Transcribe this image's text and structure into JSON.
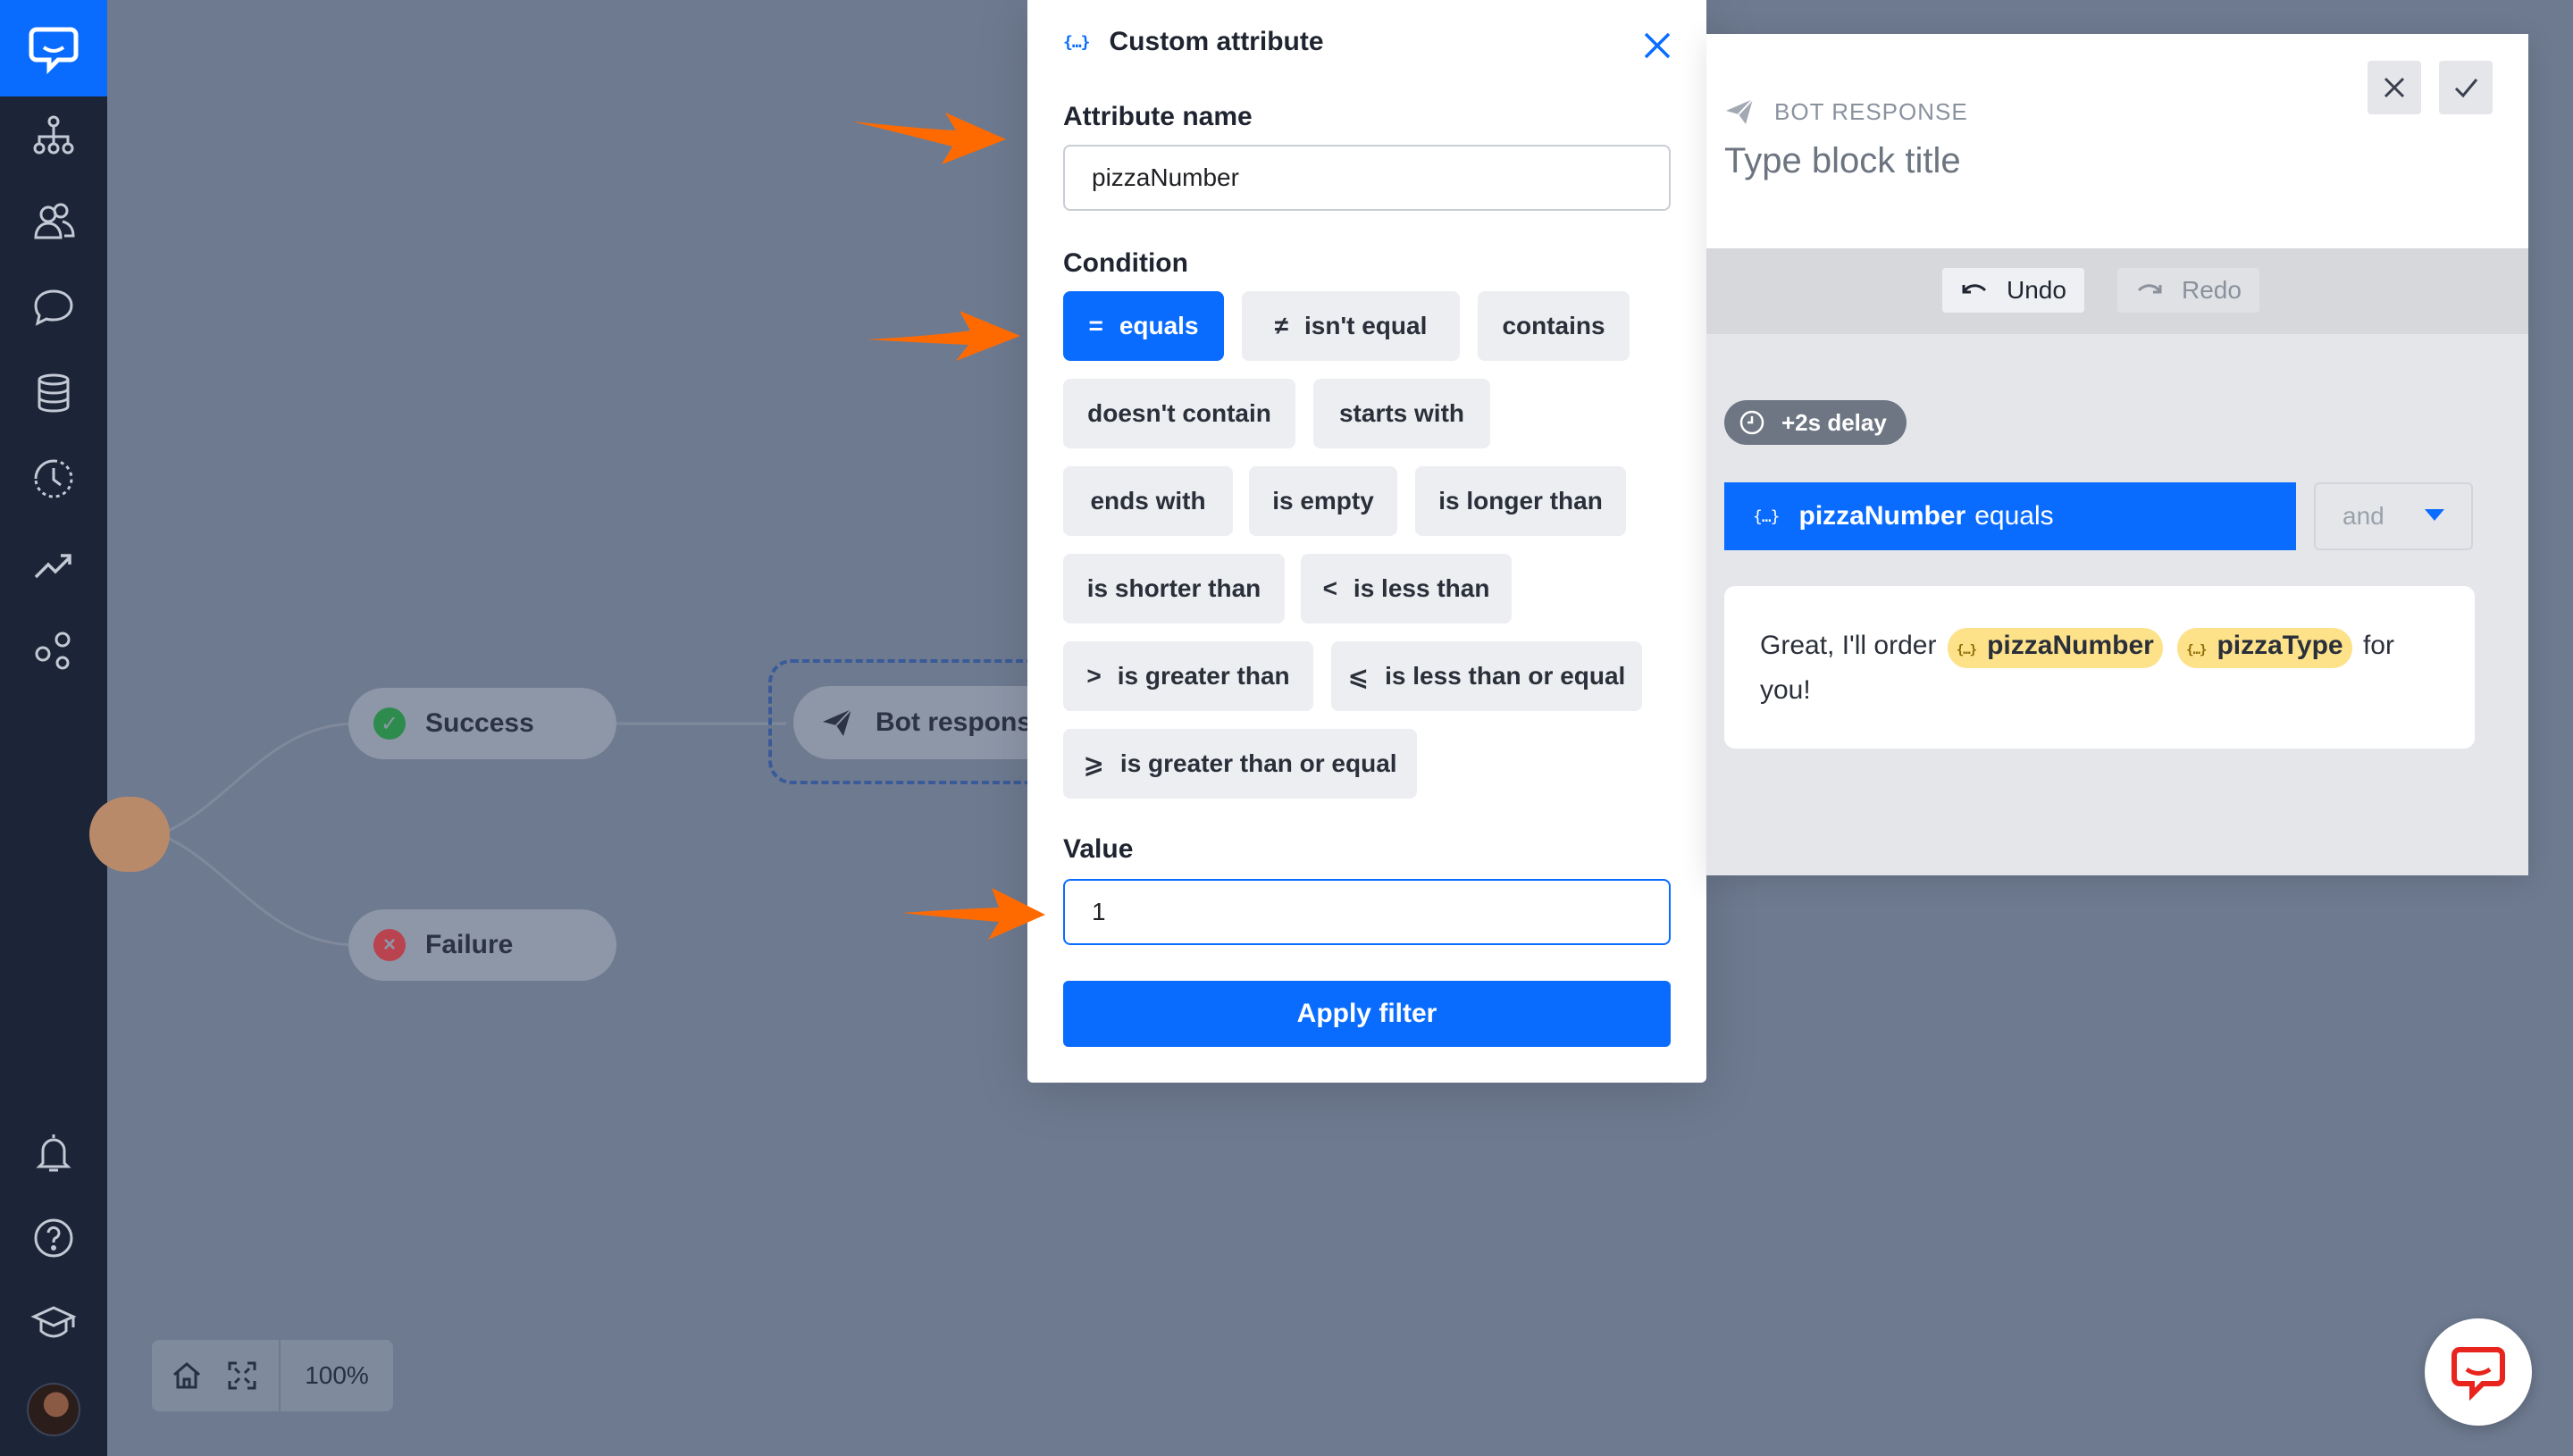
{
  "sidebar": {
    "logo_icon": "chat-logo-icon",
    "items": [
      "flows-icon",
      "users-icon",
      "chats-icon",
      "database-icon",
      "history-icon",
      "reports-icon",
      "integrations-icon"
    ],
    "bottom_items": [
      "bell-icon",
      "help-icon",
      "academy-icon",
      "avatar"
    ]
  },
  "canvas": {
    "success_label": "Success",
    "failure_label": "Failure",
    "bot_node_label": "Bot response",
    "zoom_level": "100%"
  },
  "modal": {
    "title": "Custom attribute",
    "attribute_name_label": "Attribute name",
    "attribute_name_value": "pizzaNumber",
    "condition_label": "Condition",
    "conditions": [
      {
        "symbol": "=",
        "label": "equals",
        "active": true
      },
      {
        "symbol": "≠",
        "label": "isn't equal",
        "active": false
      },
      {
        "symbol": "",
        "label": "contains",
        "active": false
      },
      {
        "symbol": "",
        "label": "doesn't contain",
        "active": false
      },
      {
        "symbol": "",
        "label": "starts with",
        "active": false
      },
      {
        "symbol": "",
        "label": "ends with",
        "active": false
      },
      {
        "symbol": "",
        "label": "is empty",
        "active": false
      },
      {
        "symbol": "",
        "label": "is longer than",
        "active": false
      },
      {
        "symbol": "",
        "label": "is shorter than",
        "active": false
      },
      {
        "symbol": "<",
        "label": "is less than",
        "active": false
      },
      {
        "symbol": ">",
        "label": "is greater than",
        "active": false
      },
      {
        "symbol": "⩽",
        "label": "is less than or equal",
        "active": false
      },
      {
        "symbol": "⩾",
        "label": "is greater than or equal",
        "active": false
      }
    ],
    "value_label": "Value",
    "value": "1",
    "apply_label": "Apply filter"
  },
  "panel": {
    "type_label": "BOT RESPONSE",
    "title_placeholder": "Type block title",
    "undo_label": "Undo",
    "redo_label": "Redo",
    "delay_label": "+2s delay",
    "condition_attr": "pizzaNumber",
    "condition_op": "equals",
    "logic_select": "and",
    "message_prefix": "Great, I'll order",
    "message_tag1": "pizzaNumber",
    "message_tag2": "pizzaType",
    "message_suffix": "for you!"
  },
  "colors": {
    "accent": "#0a6cff",
    "sidebar": "#1b2537",
    "canvas": "#6e7a90",
    "arrow": "#ff6a00",
    "tag": "#fde28a"
  }
}
